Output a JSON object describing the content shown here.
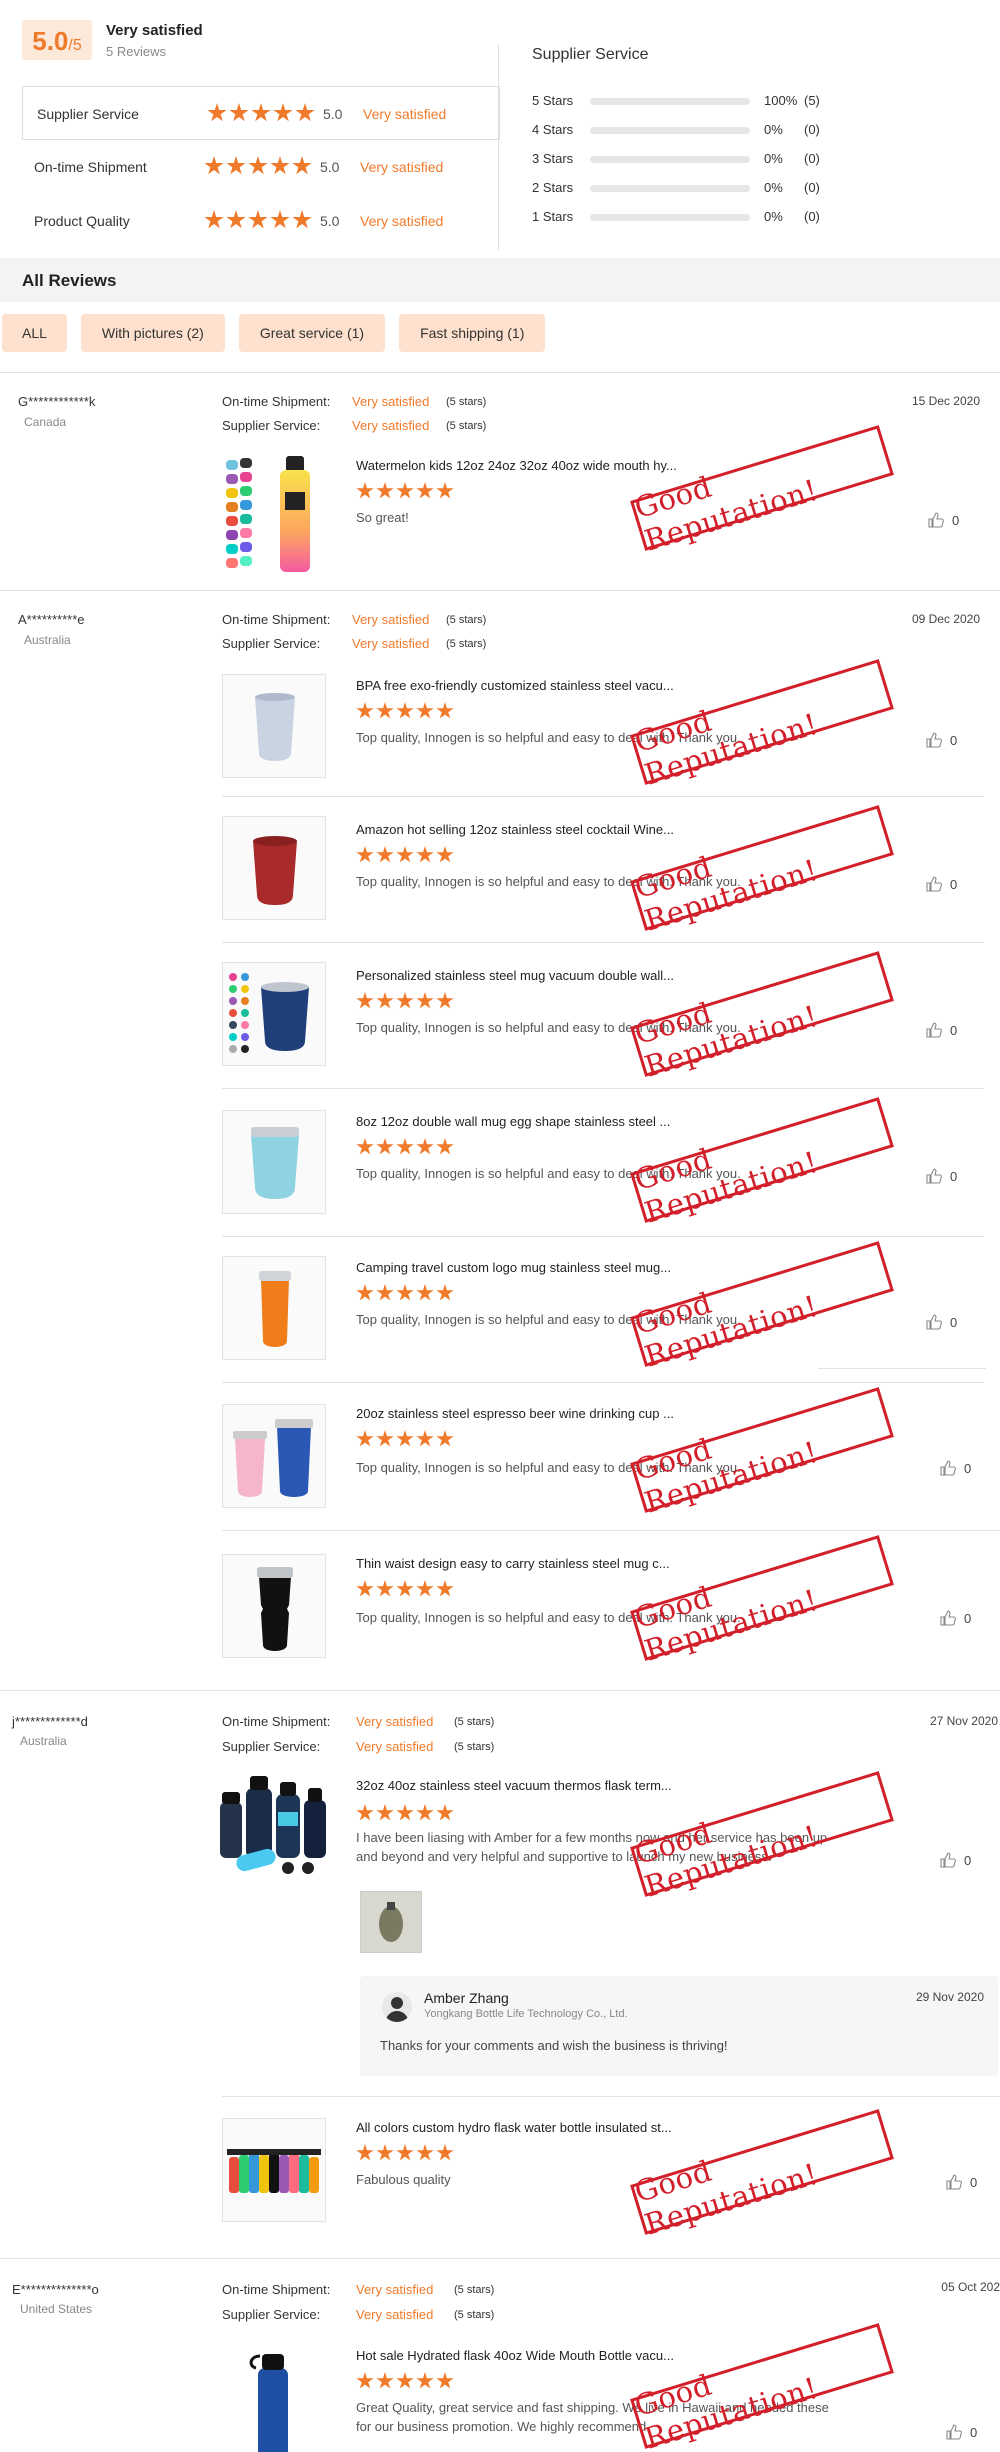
{
  "summary": {
    "score": "5.0",
    "score_of": "/5",
    "overall_label": "Very satisfied",
    "reviews_count": "5 Reviews",
    "metrics": [
      {
        "label": "Supplier Service",
        "score": "5.0",
        "text": "Very satisfied"
      },
      {
        "label": "On-time Shipment",
        "score": "5.0",
        "text": "Very satisfied"
      },
      {
        "label": "Product Quality",
        "score": "5.0",
        "text": "Very satisfied"
      }
    ],
    "distribution_title": "Supplier Service",
    "distribution": [
      {
        "label": "5 Stars",
        "pct": "100%",
        "count": "(5)",
        "fraction": 1.0
      },
      {
        "label": "4 Stars",
        "pct": "0%",
        "count": "(0)",
        "fraction": 0
      },
      {
        "label": "3 Stars",
        "pct": "0%",
        "count": "(0)",
        "fraction": 0
      },
      {
        "label": "2 Stars",
        "pct": "0%",
        "count": "(0)",
        "fraction": 0
      },
      {
        "label": "1 Stars",
        "pct": "0%",
        "count": "(0)",
        "fraction": 0
      }
    ]
  },
  "all_reviews": {
    "title": "All Reviews",
    "filters": [
      "ALL",
      "With pictures (2)",
      "Great service (1)",
      "Fast shipping (1)"
    ]
  },
  "labels": {
    "ontime": "On-time Shipment:",
    "supplier": "Supplier Service:",
    "very_satisfied": "Very satisfied",
    "five_stars": "(5 stars)",
    "stamp": "Good Reputation!"
  },
  "accent_color": "#f07a2b",
  "stamp_color": "#d21f2a",
  "reviews": [
    {
      "name": "G************k",
      "country": "Canada",
      "date": "15 Dec 2020",
      "items": [
        {
          "title": "Watermelon kids 12oz 24oz 32oz 40oz wide mouth hy...",
          "comment": "So great!",
          "likes": "0"
        }
      ]
    },
    {
      "name": "A**********e",
      "country": "Australia",
      "date": "09 Dec 2020",
      "items": [
        {
          "title": "BPA free exo-friendly customized stainless steel vacu...",
          "comment": "Top quality, Innogen is so helpful and easy to deal with. Thank you.",
          "likes": "0"
        },
        {
          "title": "Amazon hot selling 12oz stainless steel cocktail Wine...",
          "comment": "Top quality, Innogen is so helpful and easy to deal with. Thank you.",
          "likes": "0"
        },
        {
          "title": "Personalized stainless steel mug vacuum double wall...",
          "comment": "Top quality, Innogen is so helpful and easy to deal with. Thank you.",
          "likes": "0"
        },
        {
          "title": "8oz 12oz double wall mug egg shape stainless steel ...",
          "comment": "Top quality, Innogen is so helpful and easy to deal with. Thank you.",
          "likes": "0"
        },
        {
          "title": "Camping travel custom logo mug stainless steel mug...",
          "comment": "Top quality, Innogen is so helpful and easy to deal with. Thank you.",
          "likes": "0"
        },
        {
          "title": "20oz stainless steel espresso beer wine drinking cup ...",
          "comment": "Top quality, Innogen is so helpful and easy to deal with. Thank you.",
          "likes": "0"
        },
        {
          "title": "Thin waist design easy to carry stainless steel mug c...",
          "comment": "Top quality, Innogen is so helpful and easy to deal with. Thank you.",
          "likes": "0"
        }
      ]
    },
    {
      "name": "j*************d",
      "country": "Australia",
      "date": "27 Nov 2020",
      "items": [
        {
          "title": "32oz 40oz stainless steel vacuum thermos flask term...",
          "comment_lines": [
            "I have been liasing with Amber for a few months now and her service has been up",
            "and beyond and very helpful and supportive to launch my new business."
          ],
          "likes": "0"
        },
        {
          "title": "All colors custom hydro flask water bottle insulated st...",
          "comment": "Fabulous quality",
          "likes": "0"
        }
      ],
      "reply": {
        "name": "Amber Zhang",
        "company": "Yongkang Bottle Life Technology Co., Ltd.",
        "date": "29 Nov 2020",
        "text": "Thanks for your comments and wish the business is thriving!"
      }
    },
    {
      "name": "E**************o",
      "country": "United States",
      "date": "05 Oct 202",
      "items": [
        {
          "title": "Hot sale Hydrated flask 40oz Wide Mouth Bottle vacu...",
          "comment_lines": [
            "Great Quality, great service and fast shipping. We live in Hawaii and needed these",
            "for our business promotion. We highly recommend."
          ],
          "likes": "0"
        }
      ]
    }
  ]
}
